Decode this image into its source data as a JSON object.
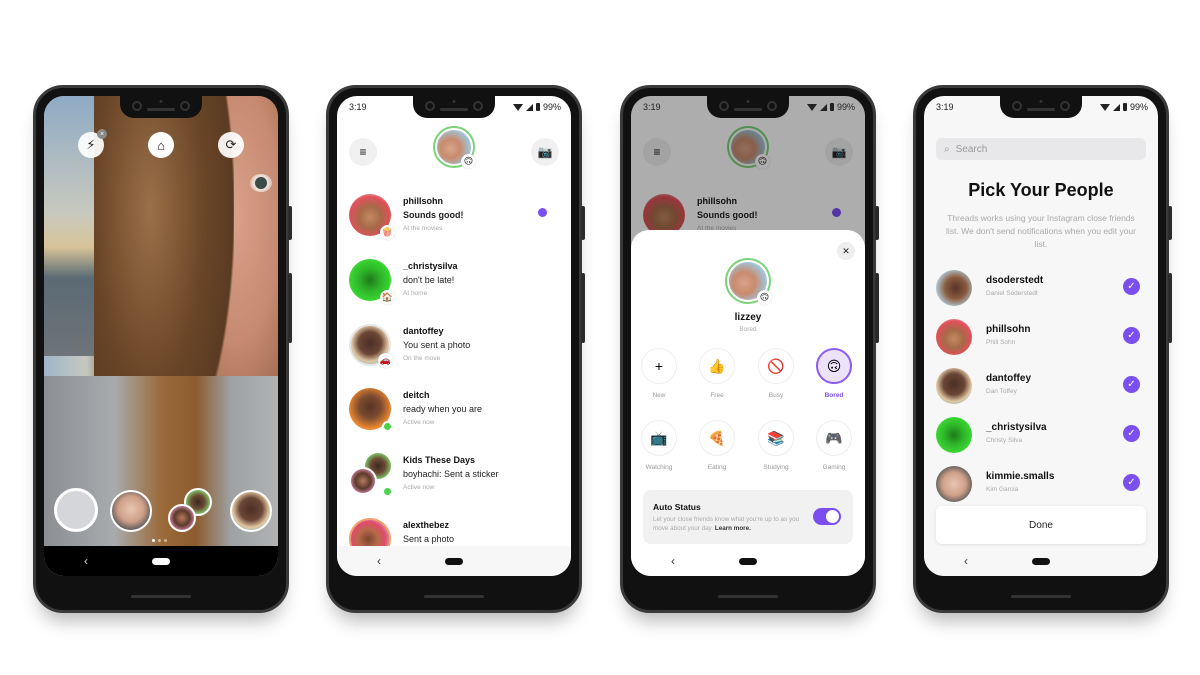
{
  "status_bar": {
    "time": "3:19",
    "battery": "99%"
  },
  "phone1": {
    "buttons": [
      {
        "name": "flash-off",
        "glyph": "⚡",
        "badge": "×"
      },
      {
        "name": "home",
        "glyph": "⌂"
      },
      {
        "name": "switch-camera",
        "glyph": "⟳"
      }
    ],
    "nav": {
      "back": "‹"
    }
  },
  "phone2": {
    "menu_glyph": "≡",
    "camera_glyph": "📷",
    "me_badge": "🙃",
    "threads": [
      {
        "name": "phillsohn",
        "message": "Sounds good!",
        "status": "At the movies",
        "badge": "🍿",
        "unread": true,
        "bold": true
      },
      {
        "name": "_christysilva",
        "message": "don't be late!",
        "status": "At home",
        "badge": "🏠"
      },
      {
        "name": "dantoffey",
        "message": "You sent a photo",
        "status": "On the move",
        "badge": "🚗"
      },
      {
        "name": "deitch",
        "message": "ready when you are",
        "status": "Active now",
        "online": true
      },
      {
        "name": "Kids These Days",
        "message": "boyhachi: Sent a sticker",
        "status": "Active now",
        "online": true
      },
      {
        "name": "alexthebez",
        "message": "Sent a photo",
        "status": ""
      }
    ],
    "nav": {
      "back": "‹"
    }
  },
  "phone3": {
    "close_glyph": "✕",
    "user": {
      "name": "lizzey",
      "status": "Bored",
      "badge": "🙃"
    },
    "options": [
      {
        "label": "New",
        "glyph": "+",
        "selected": false
      },
      {
        "label": "Free",
        "glyph": "👍",
        "selected": false
      },
      {
        "label": "Busy",
        "glyph": "🚫",
        "selected": false
      },
      {
        "label": "Bored",
        "glyph": "🙃",
        "selected": true
      },
      {
        "label": "Watching",
        "glyph": "📺",
        "selected": false
      },
      {
        "label": "Eating",
        "glyph": "🍕",
        "selected": false
      },
      {
        "label": "Studying",
        "glyph": "📚",
        "selected": false
      },
      {
        "label": "Gaming",
        "glyph": "🎮",
        "selected": false
      }
    ],
    "auto_status": {
      "title": "Auto Status",
      "description": "Let your close friends know what you're up to as you move about your day.",
      "learn_more": "Learn more.",
      "enabled": true
    },
    "nav": {
      "back": "‹"
    }
  },
  "phone4": {
    "search_placeholder": "Search",
    "search_glyph": "⌕",
    "title": "Pick Your People",
    "description": "Threads works using your Instagram close friends list. We don't send notifications when you edit your list.",
    "people": [
      {
        "username": "dsoderstedt",
        "full_name": "Daniel Soderstedt",
        "checked": true
      },
      {
        "username": "phillsohn",
        "full_name": "Phill Sohn",
        "checked": true
      },
      {
        "username": "dantoffey",
        "full_name": "Dan Toffey",
        "checked": true
      },
      {
        "username": "_christysilva",
        "full_name": "Christy Silva",
        "checked": true
      },
      {
        "username": "kimmie.smalls",
        "full_name": "Kim Garcia",
        "checked": true
      }
    ],
    "check_glyph": "✓",
    "done_label": "Done",
    "nav": {
      "back": "‹"
    }
  },
  "colors": {
    "accent": "#7b4ef0",
    "online": "#4cd24a",
    "ring": "#7dd37a"
  }
}
